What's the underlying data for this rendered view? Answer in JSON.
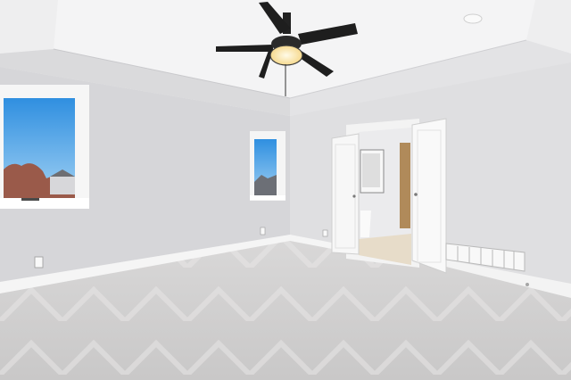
{
  "scene": {
    "kind": "photo",
    "colors": {
      "ceiling": "#f2f2f3",
      "tray_soffit": "#dcdcde",
      "wall_left": "#d7d7da",
      "wall_right": "#e0e0e2",
      "carpet": "#d2d1d1",
      "trim": "#f4f4f4",
      "sky": "#3aa0e8",
      "fan_dark": "#1e1e1e",
      "fan_light": "#fff3d0",
      "bath_floor": "#e7dcc9",
      "bath_door_wood": "#b08a5a"
    }
  }
}
